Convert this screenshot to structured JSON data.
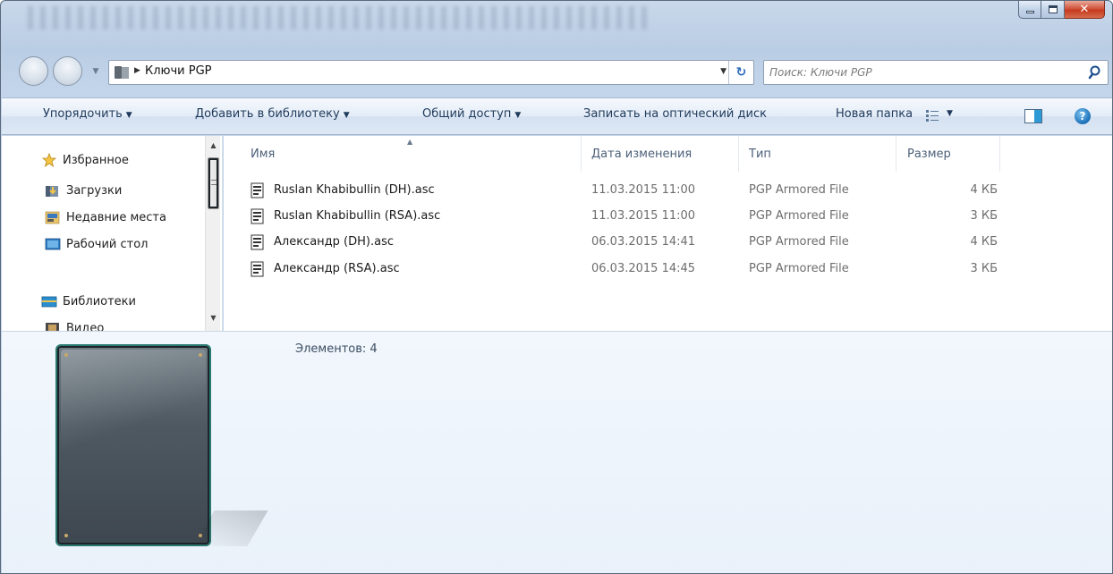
{
  "address": {
    "crumb": "Ключи PGP"
  },
  "search": {
    "placeholder": "Поиск: Ключи PGP"
  },
  "toolbar": {
    "organize": "Упорядочить",
    "add_to_library": "Добавить в библиотеку",
    "share": "Общий доступ",
    "burn": "Записать на оптический диск",
    "new_folder": "Новая папка"
  },
  "nav": {
    "favorites": "Избранное",
    "downloads": "Загрузки",
    "recent": "Недавние места",
    "desktop": "Рабочий стол",
    "libraries": "Библиотеки",
    "video": "Видео"
  },
  "columns": {
    "name": "Имя",
    "date": "Дата изменения",
    "type": "Тип",
    "size": "Размер"
  },
  "files": [
    {
      "name": "Ruslan Khabibullin (DH).asc",
      "date": "11.03.2015 11:00",
      "type": "PGP Armored File",
      "size": "4 КБ"
    },
    {
      "name": "Ruslan Khabibullin (RSA).asc",
      "date": "11.03.2015 11:00",
      "type": "PGP Armored File",
      "size": "3 КБ"
    },
    {
      "name": "Александр (DH).asc",
      "date": "06.03.2015 14:41",
      "type": "PGP Armored File",
      "size": "4 КБ"
    },
    {
      "name": "Александр (RSA).asc",
      "date": "06.03.2015 14:45",
      "type": "PGP Armored File",
      "size": "3 КБ"
    }
  ],
  "details": {
    "items_count": "Элементов: 4"
  },
  "colors": {
    "accent": "#1e395b",
    "close": "#c53a1f"
  }
}
